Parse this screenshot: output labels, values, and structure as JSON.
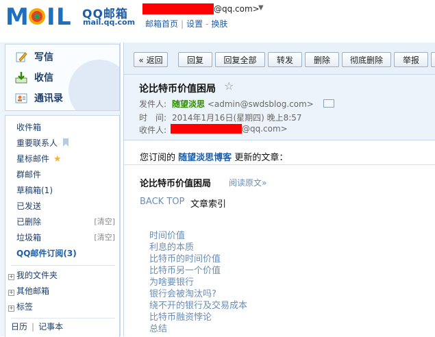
{
  "brand": {
    "logo_text": "MOIL",
    "name_cn": "QQ邮箱",
    "domain": "mail.qq.com"
  },
  "account": {
    "email_suffix": "@qq.com>",
    "caret": "▼"
  },
  "header_links": [
    "邮箱首页",
    "设置",
    "换肤"
  ],
  "sidebar": {
    "primary": [
      {
        "label": "写信",
        "icon": "pencil-icon"
      },
      {
        "label": "收信",
        "icon": "inbox-download-icon"
      },
      {
        "label": "通讯录",
        "icon": "contact-card-icon"
      }
    ],
    "folders": [
      {
        "label": "收件箱"
      },
      {
        "label": "重要联系人",
        "icon": "bookmark-icon"
      },
      {
        "label": "星标邮件",
        "icon": "star-icon"
      },
      {
        "label": "群邮件"
      },
      {
        "label": "草稿箱(1)"
      },
      {
        "label": "已发送"
      },
      {
        "label": "已删除",
        "action": "[清空]"
      },
      {
        "label": "垃圾箱",
        "action": "[清空]"
      },
      {
        "label": "QQ邮件订阅(3)",
        "bold": true
      }
    ],
    "tree": [
      "我的文件夹",
      "其他邮箱",
      "标签"
    ],
    "bottom": [
      "日历",
      "记事本"
    ]
  },
  "toolbar": {
    "buttons": [
      "« 返回",
      "回复",
      "回复全部",
      "转发",
      "删除",
      "彻底删除",
      "举报"
    ]
  },
  "mail": {
    "subject": "论比特币价值困局",
    "from_label": "发件人:",
    "from_name": "随望淡思",
    "from_email": "<admin@swdsblog.com>",
    "time_label": "时　间:",
    "time_value": "2014年1月16日(星期四) 晚上8:57",
    "to_label": "收件人:",
    "to_suffix": "@qq.com>"
  },
  "body": {
    "intro_prefix": "您订阅的",
    "blog_name": "随望淡思博客",
    "intro_suffix": "更新的文章：",
    "article_title": "论比特币价值困局",
    "read_original": "阅读原文»",
    "back_top": "BACK TOP",
    "toc_title": "文章索引",
    "toc": [
      "时间价值",
      "利息的本质",
      "比特币的时间价值",
      "比特币另一个价值",
      "为啥要银行",
      "银行会被淘汰吗?",
      "绕不开的银行及交易成本",
      "比特币融资悖论",
      "总结"
    ]
  },
  "colors": {
    "brand_blue": "#1e5ea8",
    "link_blue": "#6b8db5",
    "sender_green": "#2e8b00",
    "redaction": "#ff0000"
  }
}
